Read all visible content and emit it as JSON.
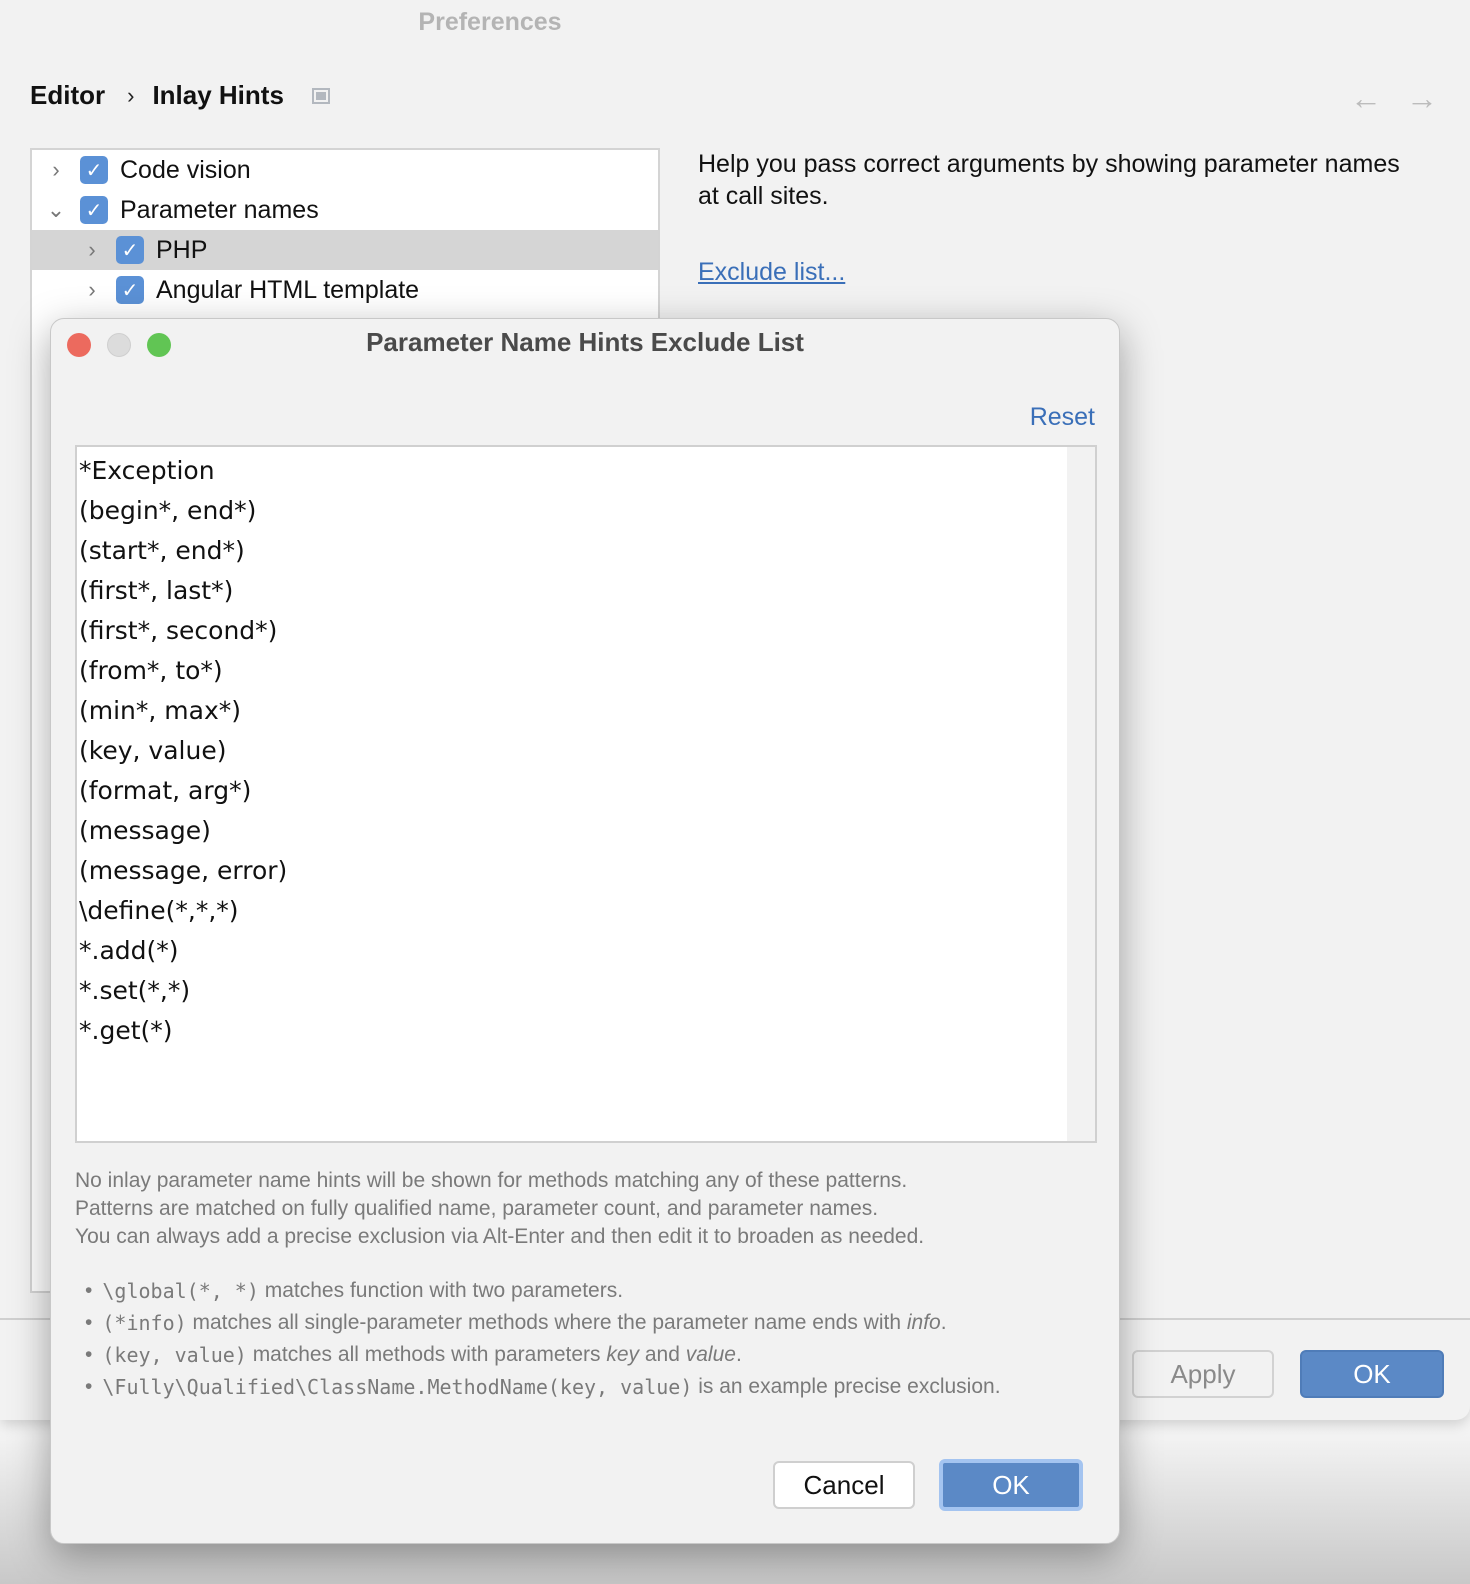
{
  "window": {
    "title": "Preferences"
  },
  "breadcrumb": {
    "parent": "Editor",
    "separator": "›",
    "current": "Inlay Hints"
  },
  "nav": {
    "back_icon": "←",
    "forward_icon": "→"
  },
  "tree": {
    "items": [
      {
        "label": "Code vision",
        "chevron": "›",
        "checked": true
      },
      {
        "label": "Parameter names",
        "chevron": "⌄",
        "checked": true
      },
      {
        "label": "PHP",
        "chevron": "›",
        "checked": true,
        "selected": true
      },
      {
        "label": "Angular HTML template",
        "chevron": "›",
        "checked": true
      }
    ]
  },
  "description": {
    "text": "Help you pass correct arguments by showing parameter names at call sites.",
    "link": "Exclude list..."
  },
  "footer": {
    "apply": "Apply",
    "ok": "OK"
  },
  "dialog": {
    "title": "Parameter Name Hints Exclude List",
    "reset": "Reset",
    "patterns": [
      "*Exception",
      "(begin*, end*)",
      "(start*, end*)",
      "(first*, last*)",
      "(first*, second*)",
      "(from*, to*)",
      "(min*, max*)",
      "(key, value)",
      "(format, arg*)",
      "(message)",
      "(message, error)",
      "\\define(*,*,*)",
      "*.add(*)",
      "*.set(*,*)",
      "*.get(*)"
    ],
    "help": [
      "No inlay parameter name hints will be shown for methods matching any of these patterns.",
      "Patterns are matched on fully qualified name, parameter count, and parameter names.",
      "You can always add a precise exclusion via Alt-Enter and then edit it to broaden as needed."
    ],
    "examples": [
      {
        "code": "\\global(*, *)",
        "text": " matches function with two parameters."
      },
      {
        "code": "(*info)",
        "text": " matches all single-parameter methods where the parameter name ends with ",
        "em": "info",
        "tail": "."
      },
      {
        "code": "(key, value)",
        "text": " matches all methods with parameters ",
        "em": "key",
        "mid": " and ",
        "em2": "value",
        "tail": "."
      },
      {
        "code": "\\Fully\\Qualified\\ClassName.MethodName(key, value)",
        "text": " is an example precise exclusion."
      }
    ],
    "cancel": "Cancel",
    "ok": "OK"
  }
}
